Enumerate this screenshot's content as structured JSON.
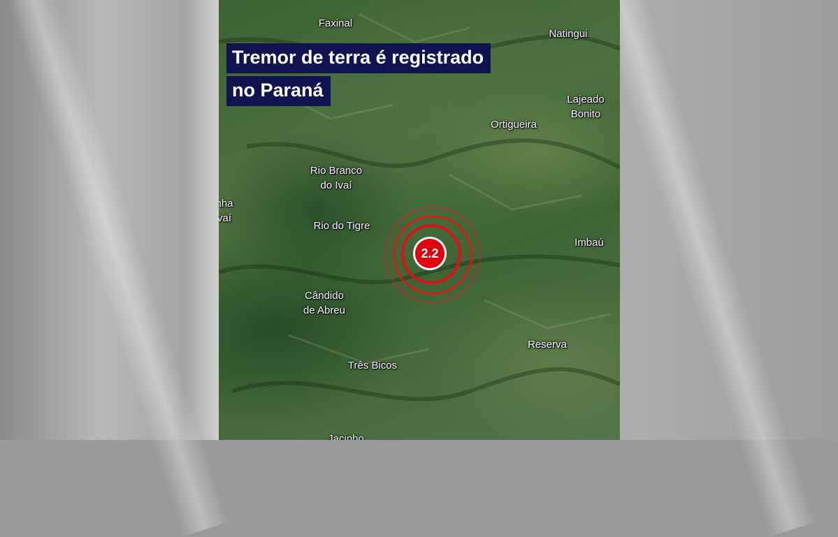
{
  "headline": {
    "line1": "Tremor de terra é registrado",
    "line2": "no Paraná"
  },
  "places": {
    "faxinal": "Faxinal",
    "natingui": "Natingui",
    "lajeado_bonito": "Lajeado\nBonito",
    "ortigueira": "Ortigueira",
    "rio_branco": "Rio Branco\ndo Ivaí",
    "partial_left": "nha\nvaí",
    "rio_do_tigre": "Rio do Tigre",
    "imbau": "Imbaú",
    "candido": "Cândido\nde Abreu",
    "reserva": "Reserva",
    "tres_bicos": "Três Bicos",
    "bottom_cut": "Jacinho"
  },
  "quake": {
    "magnitude": "2.2"
  },
  "colors": {
    "headline_bg": "#0f1450",
    "quake_red": "#e1000f"
  }
}
